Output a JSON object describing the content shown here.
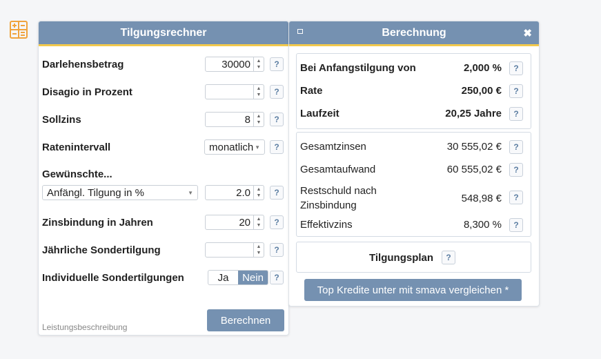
{
  "left": {
    "title": "Tilgungsrechner",
    "help": "?",
    "fields": {
      "darlehen": {
        "label": "Darlehensbetrag",
        "value": "30000"
      },
      "disagio": {
        "label": "Disagio in Prozent",
        "value": ""
      },
      "sollzins": {
        "label": "Sollzins",
        "value": "8"
      },
      "ratenintervall": {
        "label": "Ratenintervall",
        "value": "monatlich"
      },
      "gewuenscht": {
        "label": "Gewünschte...",
        "select": "Anfängl. Tilgung in %",
        "value": "2.0"
      },
      "zinsbindung": {
        "label": "Zinsbindung in Jahren",
        "value": "20"
      },
      "sondertilgung": {
        "label": "Jährliche Sondertilgung",
        "value": ""
      },
      "individuell": {
        "label": "Individuelle Sondertilgungen",
        "ja": "Ja",
        "nein": "Nein"
      }
    },
    "calculate": "Berechnen",
    "footer": "Leistungsbeschreibung"
  },
  "right": {
    "title": "Berechnung",
    "close": "✖",
    "summary": [
      {
        "label": "Bei Anfangstilgung von",
        "value": "2,000 %"
      },
      {
        "label": "Rate",
        "value": "250,00 €"
      },
      {
        "label": "Laufzeit",
        "value": "20,25 Jahre"
      }
    ],
    "details": [
      {
        "label": "Gesamtzinsen",
        "value": "30 555,02 €"
      },
      {
        "label": "Gesamtaufwand",
        "value": "60 555,02 €"
      },
      {
        "label": "Restschuld nach",
        "label2": "Zinsbindung",
        "value": "548,98 €"
      },
      {
        "label": "Effektivzins",
        "value": "8,300 %"
      }
    ],
    "plan": "Tilgungsplan",
    "compare": "Top Kredite unter mit smava vergleichen *"
  },
  "colors": {
    "accent": "#7591b1",
    "highlight": "#f2c94c",
    "help_text": "#5d7fa3"
  },
  "icons": {
    "calculator": "calculator-icon",
    "print": "print-icon",
    "close": "close-icon"
  }
}
